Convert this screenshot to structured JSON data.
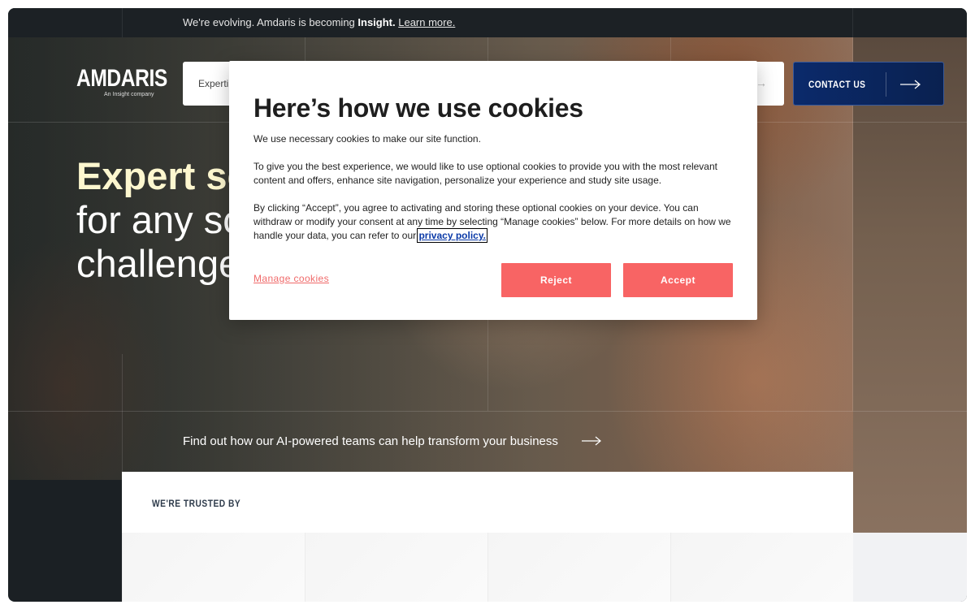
{
  "announcement": {
    "prefix": "We're evolving. Amdaris is becoming ",
    "brand": "Insight.",
    "link": "Learn more."
  },
  "header": {
    "logo_text": "AMDARIS",
    "logo_subtext": "An Insight company",
    "nav_item": "Experti",
    "contact_label": "CONTACT US"
  },
  "hero": {
    "headline_line1": "Expert se",
    "headline_line2": "for any sc",
    "headline_line3": "challenge",
    "cta_text": "Find out how our AI-powered teams can help transform your business"
  },
  "trusted": {
    "label": "WE'RE TRUSTED BY"
  },
  "cookie_modal": {
    "title": "Here’s how we use cookies",
    "p1": "We use necessary cookies to make our site function.",
    "p2": "To give you the best experience, we would like to use optional cookies to provide you with the most relevant content and offers, enhance site navigation, personalize your experience and study site usage.",
    "p3": "By clicking “Accept”, you agree to activating and storing these optional cookies on your device. You can withdraw or modify your consent at any time by selecting “Manage cookies” below. For more details on how we handle your data, you can refer to our ",
    "privacy_link": "privacy policy.",
    "manage_label": "Manage cookies",
    "reject_label": "Reject",
    "accept_label": "Accept"
  },
  "colors": {
    "accent_button": "#f86464",
    "contact_button": "#0b2a6b",
    "headline_highlight": "#fdf7cf"
  },
  "icons": [
    "arrow-right-icon"
  ]
}
